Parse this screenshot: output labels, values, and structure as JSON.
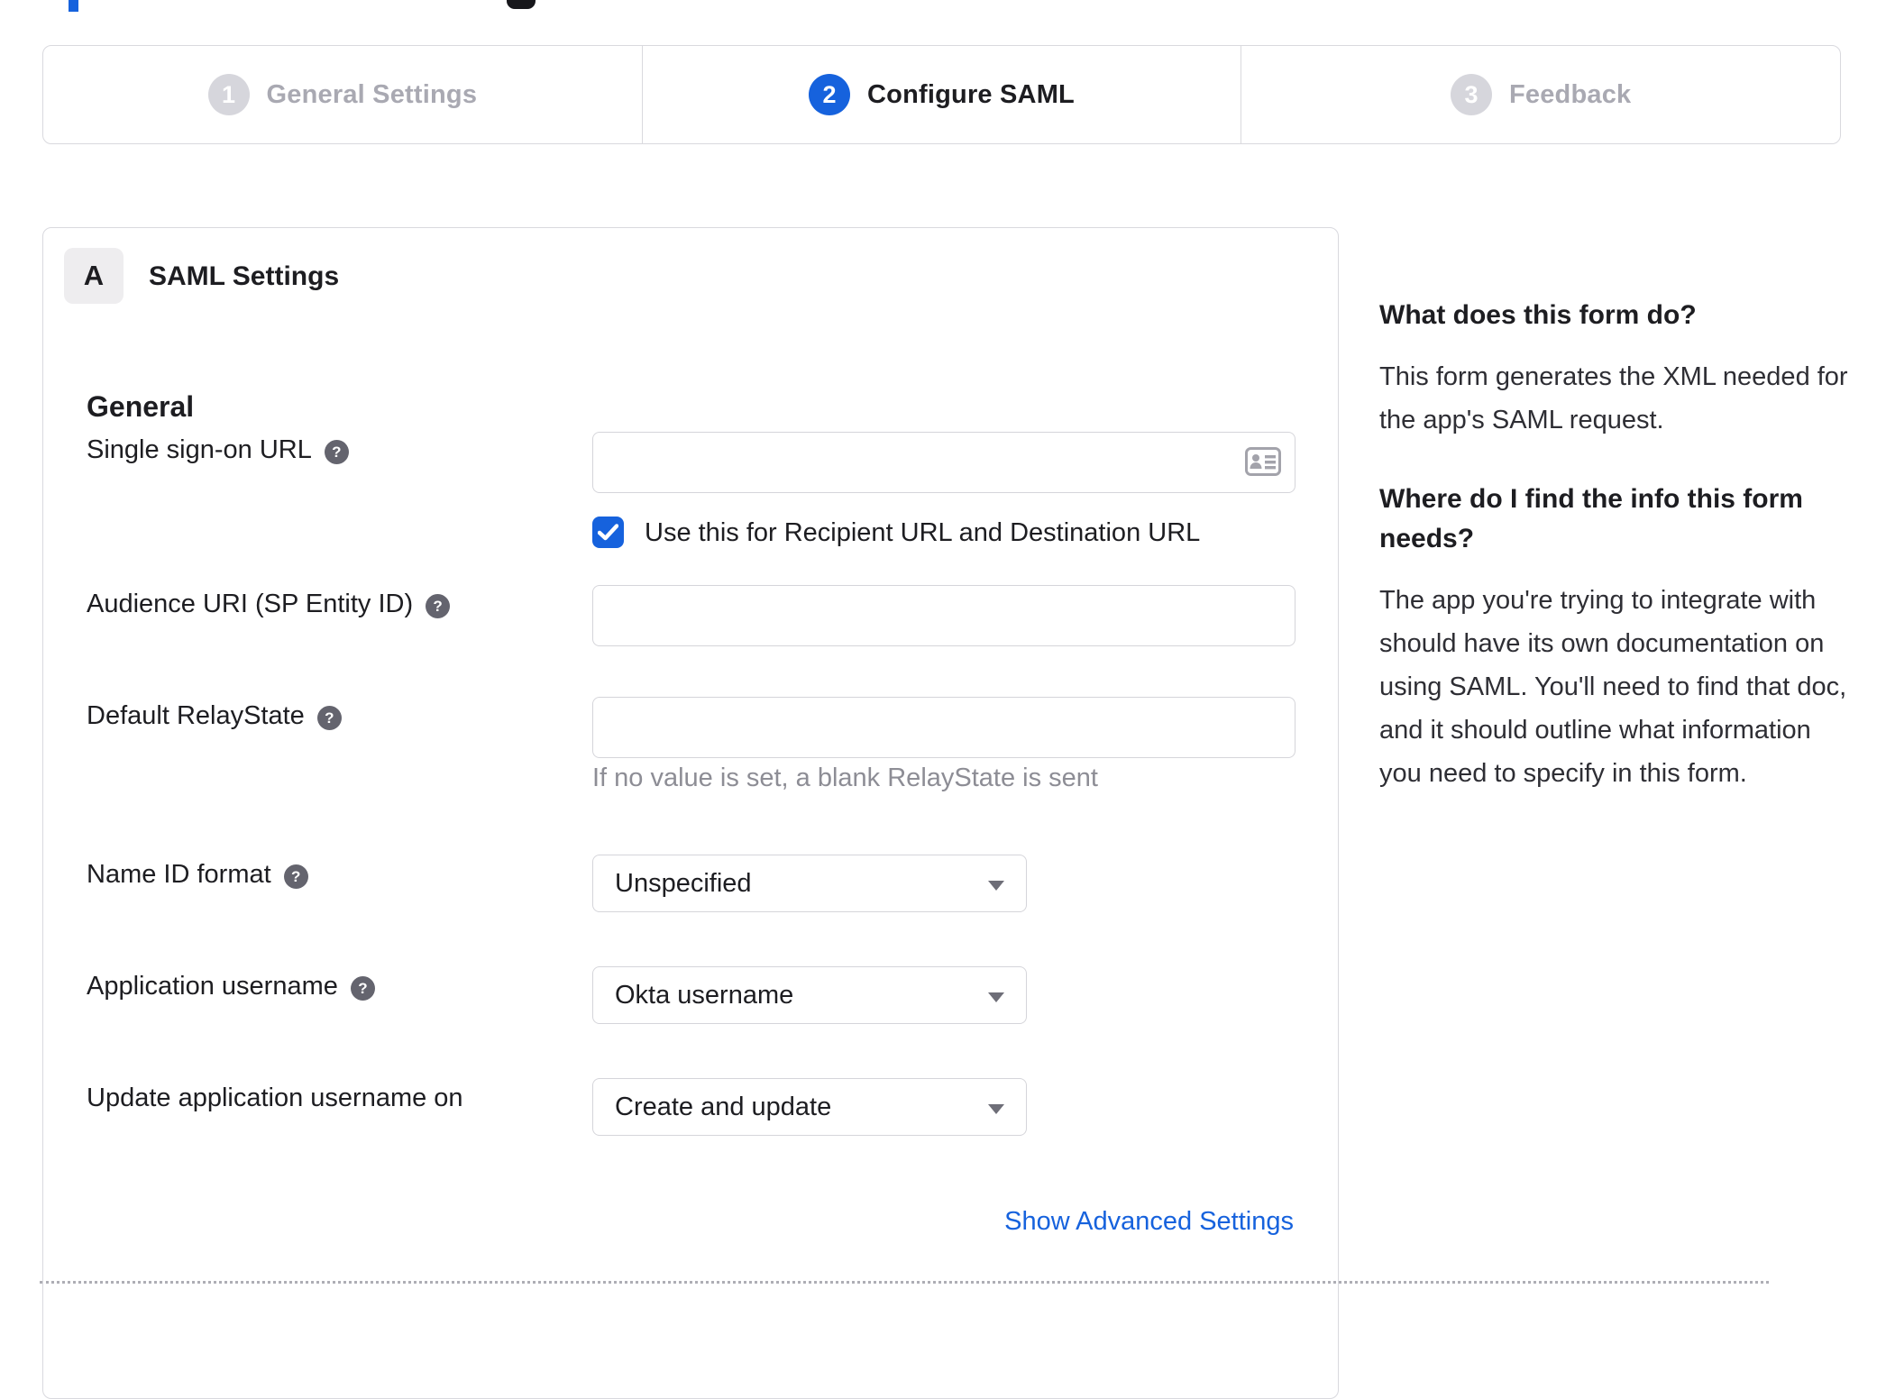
{
  "colors": {
    "accent": "#1662dd",
    "inactive_step_gray": "#d6d6dc",
    "border_gray": "#d9d9de",
    "text_dark": "#1d1d21",
    "muted_gray": "#8d8d95"
  },
  "stepper": {
    "steps": [
      {
        "number": "1",
        "label": "General Settings",
        "state": "inactive"
      },
      {
        "number": "2",
        "label": "Configure SAML",
        "state": "active"
      },
      {
        "number": "3",
        "label": "Feedback",
        "state": "inactive"
      }
    ]
  },
  "panel": {
    "badge": "A",
    "title": "SAML Settings",
    "group": "General"
  },
  "form": {
    "sso": {
      "label": "Single sign-on URL",
      "value": "",
      "checkbox_label": "Use this for Recipient URL and Destination URL",
      "checkbox_checked": true
    },
    "audience": {
      "label": "Audience URI (SP Entity ID)",
      "value": ""
    },
    "relay": {
      "label": "Default RelayState",
      "value": "",
      "hint": "If no value is set, a blank RelayState is sent"
    },
    "name_id": {
      "label": "Name ID format",
      "value": "Unspecified"
    },
    "app_username": {
      "label": "Application username",
      "value": "Okta username"
    },
    "update_username": {
      "label": "Update application username on",
      "value": "Create and update"
    },
    "advanced_link": "Show Advanced Settings"
  },
  "icons": {
    "help": "?"
  },
  "sidebar": {
    "q1": "What does this form do?",
    "a1": "This form generates the XML needed for the app's SAML request.",
    "q2": "Where do I find the info this form needs?",
    "a2": "The app you're trying to integrate with should have its own documentation on using SAML. You'll need to find that doc, and it should outline what information you need to specify in this form."
  }
}
